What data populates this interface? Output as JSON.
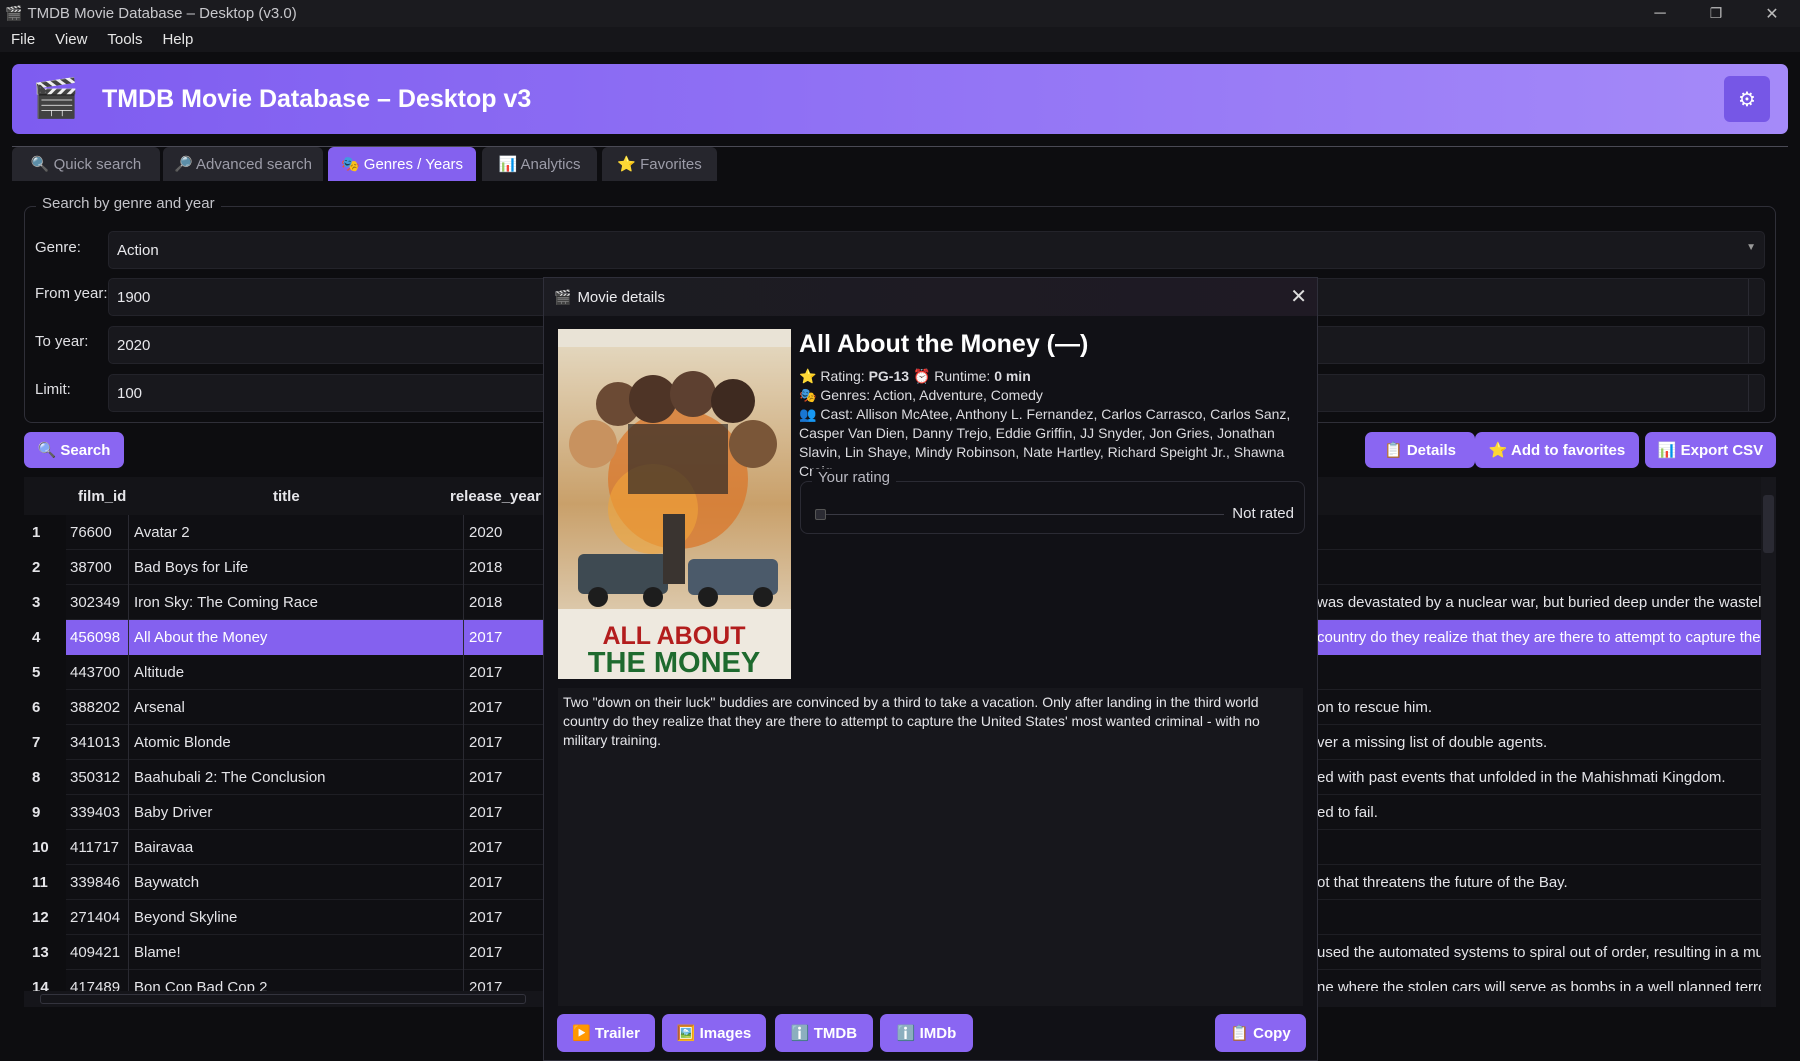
{
  "window": {
    "title": "TMDB Movie Database – Desktop (v3.0)",
    "minimize": "─",
    "maximize": "❐",
    "close": "✕"
  },
  "menu": [
    "File",
    "View",
    "Tools",
    "Help"
  ],
  "banner": {
    "title": "TMDB Movie Database – Desktop v3",
    "logo_icon": "clapperboard-icon",
    "settings_icon": "gear-icon"
  },
  "tabs": [
    {
      "label": "🔍 Quick search"
    },
    {
      "label": "🔎 Advanced search"
    },
    {
      "label": "🎭 Genres / Years"
    },
    {
      "label": "📊 Analytics"
    },
    {
      "label": "⭐ Favorites"
    }
  ],
  "active_tab": 2,
  "form": {
    "legend": "Search by genre and year",
    "genre_label": "Genre:",
    "genre_value": "Action",
    "from_label": "From year:",
    "from_value": "1900",
    "to_label": "To year:",
    "to_value": "2020",
    "limit_label": "Limit:",
    "limit_value": "100"
  },
  "actions": {
    "search": "🔍 Search",
    "details": "📋 Details",
    "add_favorites": "⭐ Add to favorites",
    "export": "📊 Export CSV"
  },
  "table": {
    "columns": [
      "film_id",
      "title",
      "release_year"
    ],
    "rows": [
      {
        "n": "1",
        "id": "76600",
        "title": "Avatar 2",
        "year": "2020",
        "tail": ""
      },
      {
        "n": "2",
        "id": "38700",
        "title": "Bad Boys for Life",
        "year": "2018",
        "tail": ""
      },
      {
        "n": "3",
        "id": "302349",
        "title": "Iron Sky: The Coming Race",
        "year": "2018",
        "tail": "was devastated by a nuclear war, but buried deep under the wasteland"
      },
      {
        "n": "4",
        "id": "456098",
        "title": "All About the Money",
        "year": "2017",
        "tail": "country do they realize that they are there to attempt to capture the Un"
      },
      {
        "n": "5",
        "id": "443700",
        "title": "Altitude",
        "year": "2017",
        "tail": ""
      },
      {
        "n": "6",
        "id": "388202",
        "title": "Arsenal",
        "year": "2017",
        "tail": "on to rescue him."
      },
      {
        "n": "7",
        "id": "341013",
        "title": "Atomic Blonde",
        "year": "2017",
        "tail": "ver a missing list of double agents."
      },
      {
        "n": "8",
        "id": "350312",
        "title": "Baahubali 2: The Conclusion",
        "year": "2017",
        "tail": "ed with past events that unfolded in the Mahishmati Kingdom."
      },
      {
        "n": "9",
        "id": "339403",
        "title": "Baby Driver",
        "year": "2017",
        "tail": "ed to fail."
      },
      {
        "n": "10",
        "id": "411717",
        "title": "Bairavaa",
        "year": "2017",
        "tail": ""
      },
      {
        "n": "11",
        "id": "339846",
        "title": "Baywatch",
        "year": "2017",
        "tail": "ot that threatens the future of the Bay."
      },
      {
        "n": "12",
        "id": "271404",
        "title": "Beyond Skyline",
        "year": "2017",
        "tail": ""
      },
      {
        "n": "13",
        "id": "409421",
        "title": "Blame!",
        "year": "2017",
        "tail": "used the automated systems to spiral out of order, resulting in a multi-"
      },
      {
        "n": "14",
        "id": "417489",
        "title": "Bon Cop Bad Cop 2",
        "year": "2017",
        "tail": "ne where the stolen cars will serve as bombs in a well planned terrorist"
      }
    ],
    "selected_row": 3
  },
  "dialog": {
    "title": "Movie details",
    "movie_title": "All About the Money (—)",
    "rating_label": "Rating:",
    "rating_value": "PG-13",
    "runtime_label": "Runtime:",
    "runtime_value": "0 min",
    "genres": "Genres: Action, Adventure, Comedy",
    "cast": "Cast: Allison McAtee, Anthony L. Fernandez, Carlos Carrasco, Carlos Sanz, Casper Van Dien, Danny Trejo, Eddie Griffin, JJ Snyder, Jon Gries, Jonathan Slavin, Lin Shaye, Mindy Robinson, Nate Hartley, Richard Speight Jr., Shawna Craig",
    "poster_text": "ALL ABOUT THE MONEY",
    "your_rating_legend": "Your rating",
    "your_rating_value": "Not rated",
    "overview": "Two \"down on their luck\" buddies are convinced by a third to take a vacation. Only after landing in the third world country do they realize that they are there to attempt to capture the United States' most wanted criminal - with no military training.",
    "buttons": {
      "trailer": "▶️ Trailer",
      "images": "🖼️ Images",
      "tmdb": "ℹ️ TMDB",
      "imdb": "ℹ️ IMDb",
      "copy": "📋 Copy"
    }
  },
  "colors": {
    "accent": "#8461ef",
    "background": "#0d0d10",
    "banner_start": "#7e5cf0",
    "banner_end": "#a58af9"
  }
}
